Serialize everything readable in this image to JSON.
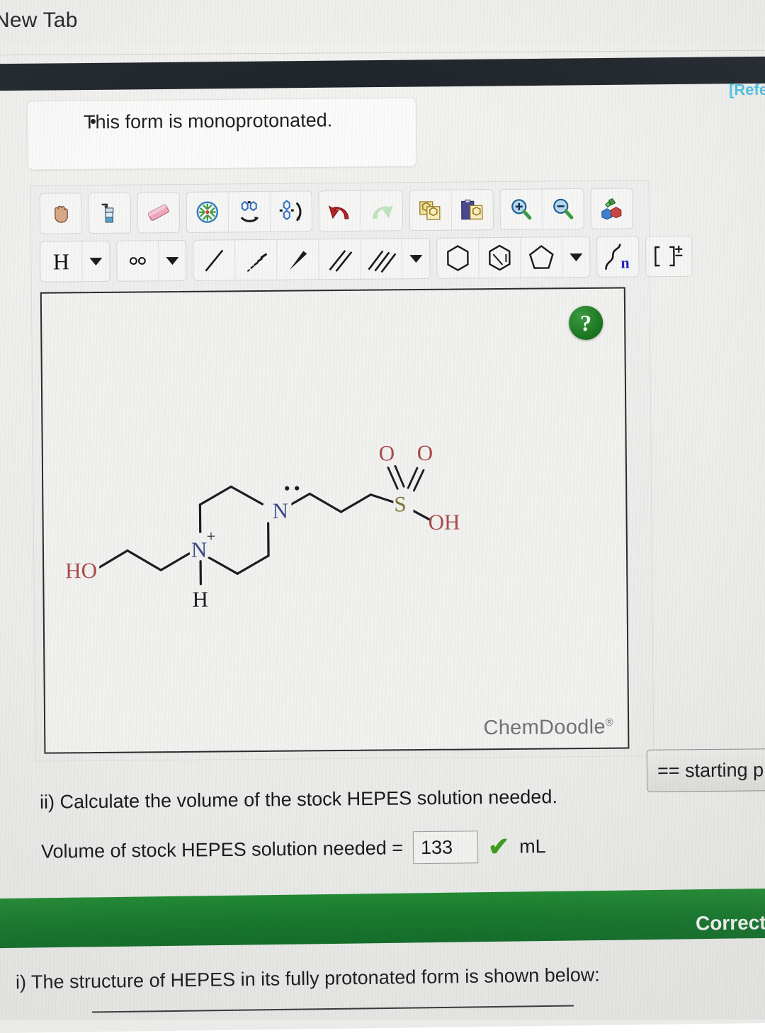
{
  "browser": {
    "tab_title": "New Tab",
    "ref_link": "[Refe"
  },
  "statement": {
    "bullet_text": "This form is monoprotonated."
  },
  "sketcher": {
    "name": "ChemDoodle sketcher",
    "watermark": "ChemDoodle",
    "watermark_mark": "®",
    "help_glyph": "?",
    "toolbar_row1": [
      {
        "name": "pan-hand-icon",
        "label": "Pan"
      },
      {
        "name": "clear-spray-icon",
        "label": "Clear"
      },
      {
        "name": "eraser-icon",
        "label": "Erase"
      },
      {
        "name": "optimize-layout-icon",
        "label": "Clean up structure"
      },
      {
        "name": "flip-horizontal-icon",
        "label": "Flip horizontal"
      },
      {
        "name": "flip-vertical-icon",
        "label": "Flip vertical"
      },
      {
        "name": "undo-icon",
        "label": "Undo"
      },
      {
        "name": "redo-icon",
        "label": "Redo"
      },
      {
        "name": "copy-icon",
        "label": "Copy"
      },
      {
        "name": "paste-icon",
        "label": "Paste"
      },
      {
        "name": "zoom-in-icon",
        "label": "Zoom in"
      },
      {
        "name": "zoom-out-icon",
        "label": "Zoom out"
      },
      {
        "name": "templates-icon",
        "label": "Templates"
      }
    ],
    "toolbar_row2": [
      {
        "name": "element-h-button",
        "label": "H"
      },
      {
        "name": "element-h-dropdown",
        "label": "▼"
      },
      {
        "name": "lone-pair-button",
        "label": "o o"
      },
      {
        "name": "lone-pair-dropdown",
        "label": "▼"
      },
      {
        "name": "single-bond-icon",
        "label": "Single bond"
      },
      {
        "name": "hashed-bond-icon",
        "label": "Hashed wedge bond"
      },
      {
        "name": "wedge-bond-icon",
        "label": "Wedge bond"
      },
      {
        "name": "double-bond-icon",
        "label": "Double bond"
      },
      {
        "name": "triple-bond-icon",
        "label": "Triple bond"
      },
      {
        "name": "bond-dropdown",
        "label": "▼"
      },
      {
        "name": "cyclohexane-ring-icon",
        "label": "Cyclohexane"
      },
      {
        "name": "benzene-ring-icon",
        "label": "Benzene"
      },
      {
        "name": "cyclopentane-ring-icon",
        "label": "Cyclopentane"
      },
      {
        "name": "ring-dropdown",
        "label": "▼"
      },
      {
        "name": "polymer-repeat-icon",
        "label": "n"
      },
      {
        "name": "charge-bracket-icon",
        "label": "[ ]±"
      }
    ],
    "molecule": {
      "name": "HEPES monoprotonated",
      "labels": {
        "hydroxyl": "HO",
        "n_plus": "N",
        "n_plus_charge": "+",
        "n_plus_hydrogen": "H",
        "n_neutral": "N",
        "sulfur": "S",
        "oxygen_left": "O",
        "oxygen_right": "O",
        "hydroxyl_sulfonic": "OH"
      },
      "colors": {
        "oxygen": "#a94b4b",
        "nitrogen": "#3b4a8c",
        "sulfur": "#7d7333",
        "bond": "#1c1c24"
      }
    }
  },
  "starting_point_button": {
    "label": "== starting p"
  },
  "question_ii": {
    "prompt": "ii) Calculate the volume of the stock HEPES solution needed.",
    "answer_label": "Volume of stock HEPES solution needed  =",
    "answer_value": "133",
    "answer_unit": "mL",
    "check_glyph": "✔"
  },
  "status_banner": {
    "label": "Correct",
    "color": "#13762a"
  },
  "question_i": {
    "prompt": "i) The structure of HEPES in its fully protonated form is shown below:"
  }
}
